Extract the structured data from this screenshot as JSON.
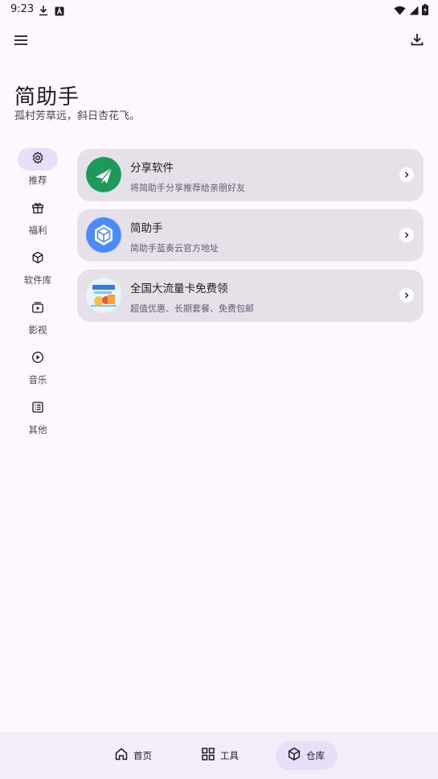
{
  "status_bar": {
    "time": "9:23",
    "icons_left": [
      "download-arrow-icon",
      "a-badge-icon"
    ],
    "icons_right": [
      "wifi-icon",
      "signal-icon",
      "battery-charging-icon"
    ]
  },
  "top_bar": {
    "menu_icon": "hamburger-menu-icon",
    "download_icon": "download-icon"
  },
  "header": {
    "title": "简助手",
    "subtitle": "孤村芳草远，斜日杏花飞。"
  },
  "nav_rail": {
    "active_index": 0,
    "items": [
      {
        "label": "推荐",
        "icon": "settings-gear-icon"
      },
      {
        "label": "福利",
        "icon": "gift-icon"
      },
      {
        "label": "软件库",
        "icon": "cube-icon"
      },
      {
        "label": "影视",
        "icon": "tv-play-icon"
      },
      {
        "label": "音乐",
        "icon": "play-circle-icon"
      },
      {
        "label": "其他",
        "icon": "list-icon"
      }
    ]
  },
  "cards": [
    {
      "title": "分享软件",
      "desc": "将简助手分享推荐给亲朋好友",
      "icon": "paper-plane-icon",
      "color": "#1b9a59"
    },
    {
      "title": "简助手",
      "desc": "简助手蓝奏云官方地址",
      "icon": "cube-app-icon",
      "color": "#4a8cf7"
    },
    {
      "title": "全国大流量卡免费领",
      "desc": "超值优惠、长期套餐、免费包邮",
      "icon": "sim-card-promo-icon",
      "color": "#cde6f7"
    }
  ],
  "bottom_nav": {
    "active_index": 2,
    "tabs": [
      {
        "label": "首页",
        "icon": "home-icon"
      },
      {
        "label": "工具",
        "icon": "grid-apps-icon"
      },
      {
        "label": "仓库",
        "icon": "box-icon"
      }
    ]
  },
  "colors": {
    "background": "#fdf7ff",
    "card": "#e6e0e9",
    "active_indicator": "#e8def8",
    "bottom_bar": "#f3edf7"
  }
}
